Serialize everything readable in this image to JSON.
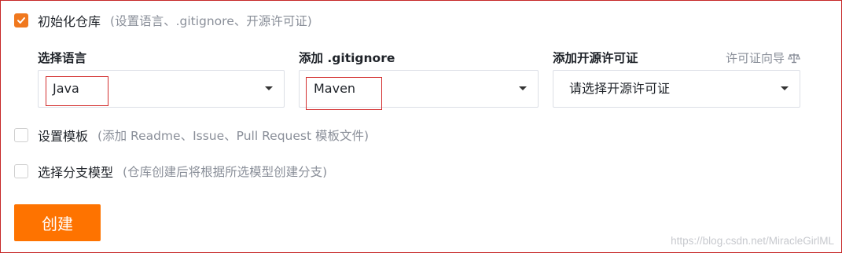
{
  "init_repo": {
    "checked": true,
    "label": "初始化仓库",
    "hint": "(设置语言、.gitignore、开源许可证)"
  },
  "language": {
    "label": "选择语言",
    "value": "Java"
  },
  "gitignore": {
    "label": "添加 .gitignore",
    "value": "Maven"
  },
  "license": {
    "label": "添加开源许可证",
    "guide_label": "许可证向导",
    "guide_icon": "scale-icon",
    "value": "请选择开源许可证"
  },
  "template": {
    "checked": false,
    "label": "设置模板",
    "hint": "(添加 Readme、Issue、Pull Request 模板文件)"
  },
  "branch_model": {
    "checked": false,
    "label": "选择分支模型",
    "hint": "(仓库创建后将根据所选模型创建分支)"
  },
  "create_button": {
    "label": "创建"
  },
  "watermark": "https://blog.csdn.net/MiracleGirlML",
  "colors": {
    "accent": "#fe7300",
    "annotation": "#d32f2f"
  }
}
